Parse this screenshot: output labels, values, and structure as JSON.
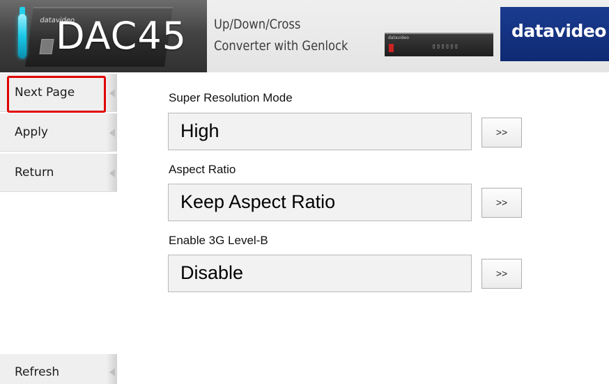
{
  "banner": {
    "model": "DAC45",
    "device_mini_label": "datavideo",
    "tagline_line1": "Up/Down/Cross",
    "tagline_line2": "Converter with Genlock",
    "strip_label": "datavideo",
    "brand": "datavideo"
  },
  "sidebar": {
    "items": [
      {
        "label": "Next Page"
      },
      {
        "label": "Apply"
      },
      {
        "label": "Return"
      },
      {
        "label": "Refresh"
      }
    ]
  },
  "settings": [
    {
      "label": "Super Resolution Mode",
      "value": "High",
      "button": ">>"
    },
    {
      "label": "Aspect Ratio",
      "value": "Keep Aspect Ratio",
      "button": ">>"
    },
    {
      "label": "Enable 3G Level-B",
      "value": "Disable",
      "button": ">>"
    }
  ],
  "colors": {
    "highlight": "#e00000",
    "accent": "#19c7e6",
    "brand_blue": "#1a3b8f"
  }
}
